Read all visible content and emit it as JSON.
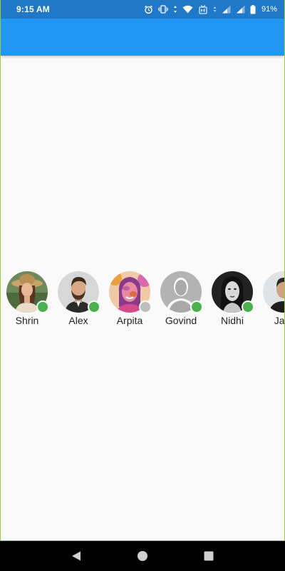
{
  "status_bar": {
    "time": "9:15 AM",
    "battery": "91%",
    "icons": [
      "alarm-icon",
      "vibrate-icon",
      "data-arrows-icon",
      "wifi-icon",
      "volte-icon",
      "signal-icon",
      "signal-icon",
      "battery-icon"
    ]
  },
  "app_bar": {
    "color": "#2196f3"
  },
  "stories": [
    {
      "name": "Shrin",
      "online": true,
      "avatar": "woman-hat-photo"
    },
    {
      "name": "Alex",
      "online": true,
      "avatar": "man-beard-photo"
    },
    {
      "name": "Arpita",
      "online": false,
      "avatar": "woman-holi-photo"
    },
    {
      "name": "Govind",
      "online": true,
      "avatar": "placeholder-silhouette"
    },
    {
      "name": "Nidhi",
      "online": true,
      "avatar": "woman-bw-photo"
    },
    {
      "name": "Jam",
      "online": false,
      "avatar": "man-photo"
    }
  ],
  "colors": {
    "online": "#4caf50",
    "offline": "#bdbdbd"
  },
  "nav_bar": {
    "buttons": [
      "back-icon",
      "home-icon",
      "recents-icon"
    ]
  }
}
